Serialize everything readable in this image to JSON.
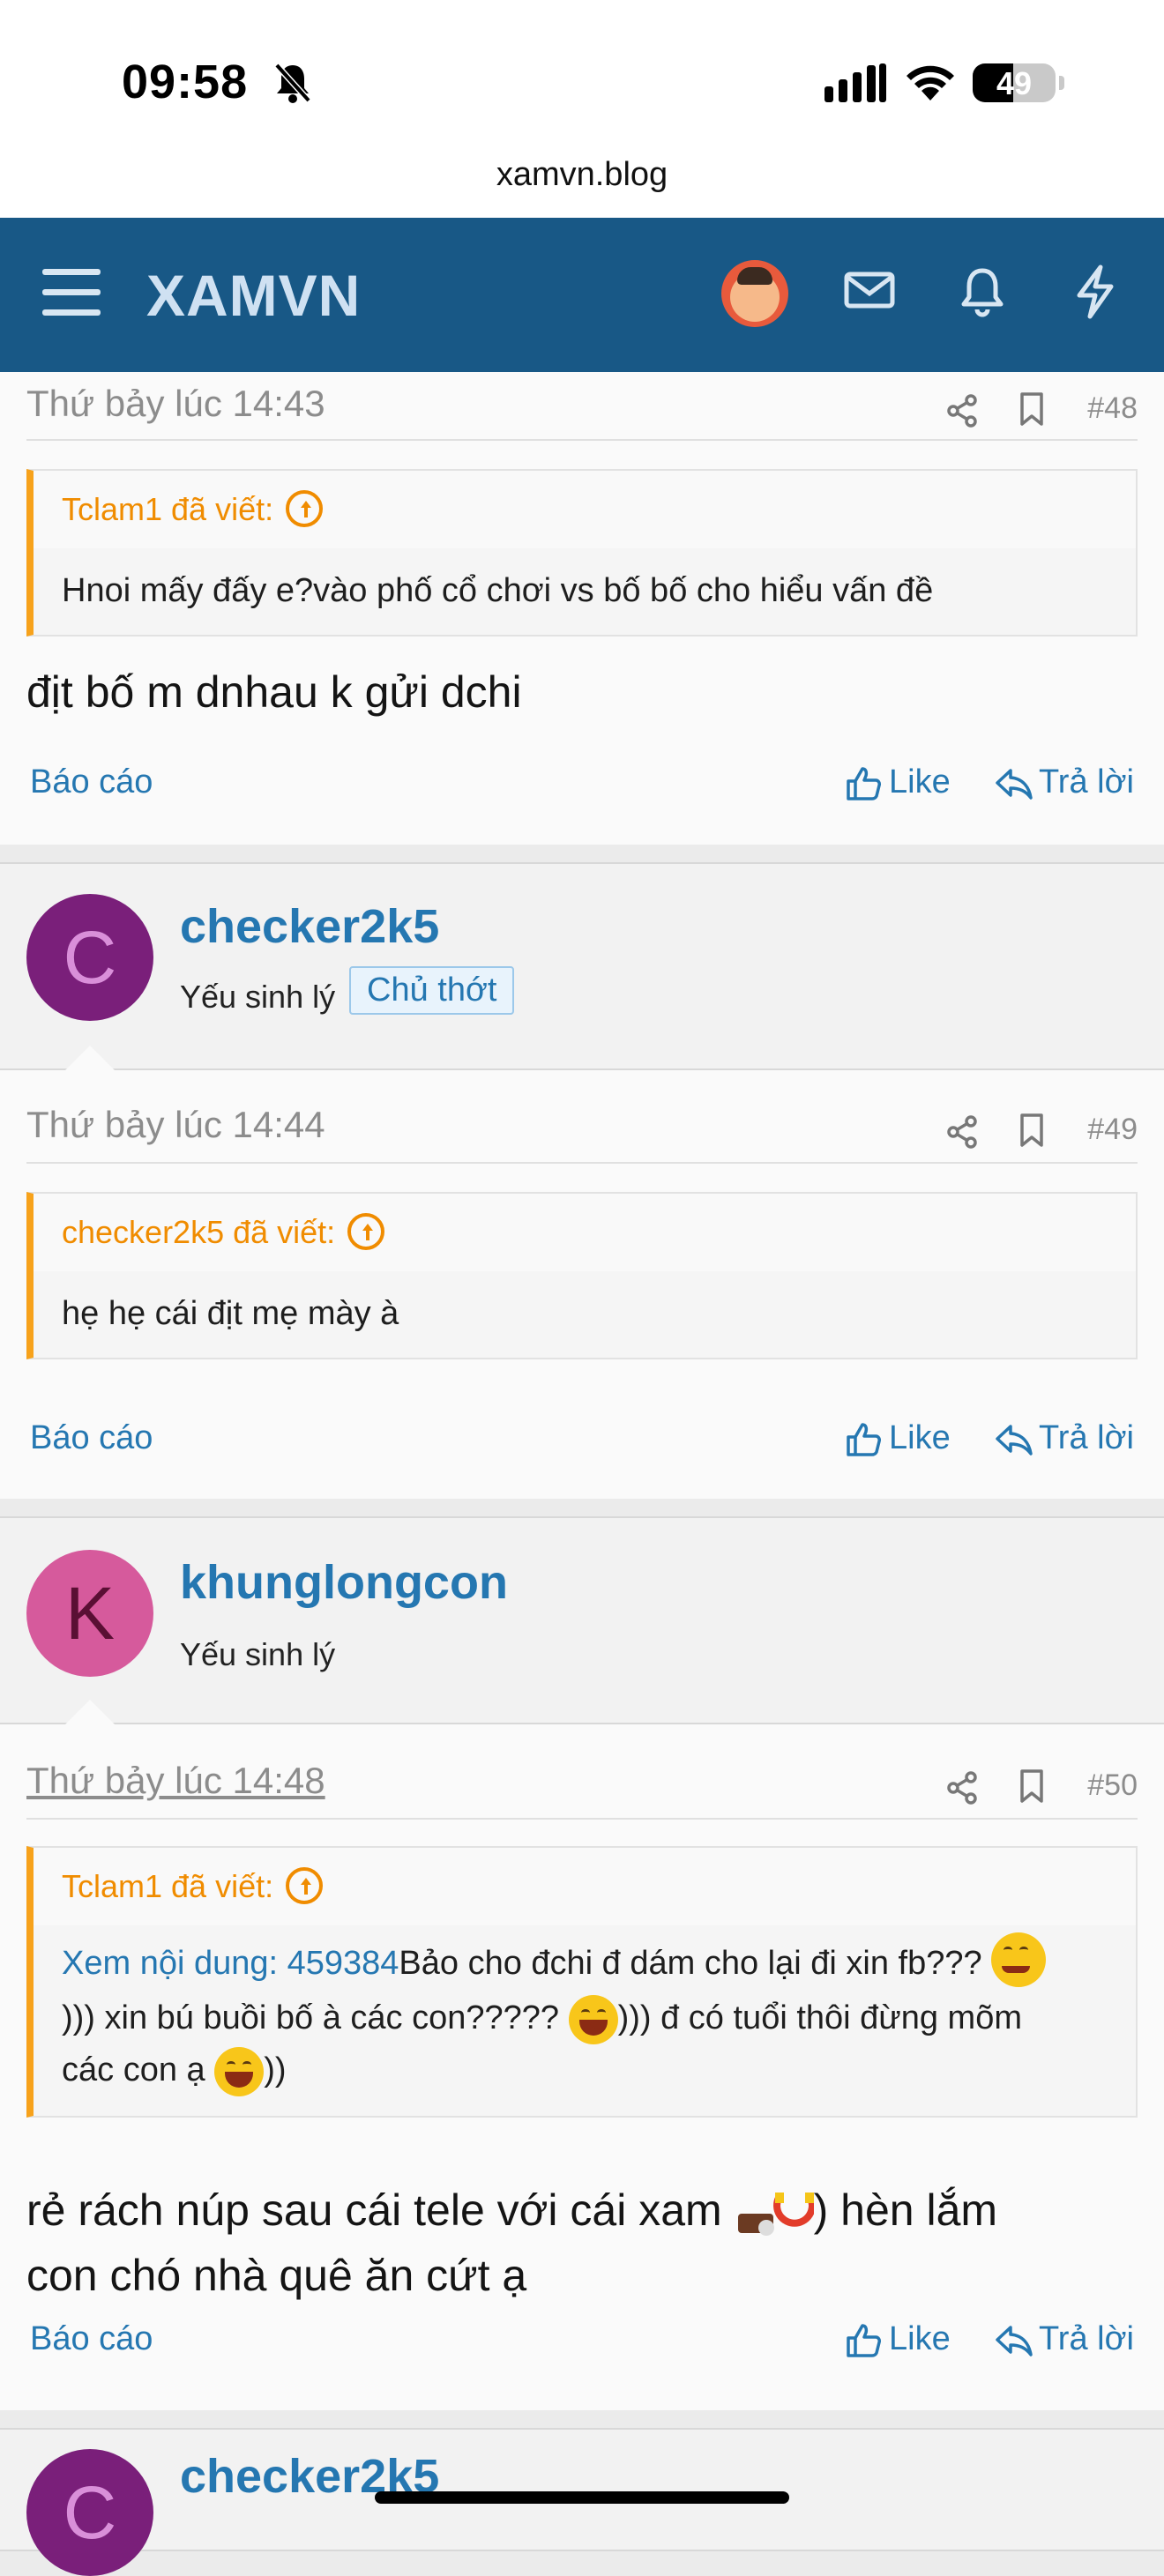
{
  "status": {
    "time": "09:58",
    "battery": "49"
  },
  "browser": {
    "url": "xamvn.blog"
  },
  "app": {
    "brand": "XAMVN"
  },
  "posts": [
    {
      "time": "Thứ bảy lúc 14:43",
      "number": "#48",
      "quote_author": "Tclam1 đã viết:",
      "quote_text": "Hnoi mấy đấy e?vào phố cổ chơi vs bố bố cho hiểu vấn đề",
      "message": "địt bố m dnhau k gửi dchi",
      "report": "Báo cáo",
      "like": "Like",
      "reply": "Trả lời"
    },
    {
      "time": "Thứ bảy lúc 14:44",
      "number": "#49",
      "quote_author": "checker2k5 đã viết:",
      "quote_text": "hẹ hẹ cái địt mẹ mày à",
      "report": "Báo cáo",
      "like": "Like",
      "reply": "Trả lời"
    },
    {
      "time": "Thứ bảy lúc 14:48",
      "number": "#50",
      "quote_author": "Tclam1 đã viết:",
      "quote_link": "Xem nội dung: 459384",
      "quote_line1": "Bảo cho đchi đ dám cho lại đi xin fb???",
      "quote_line2": "))) xin bú buồi bố à các con?????",
      "quote_line2b": "))) đ có tuổi thôi đừng mõm",
      "quote_line3": "các con ạ",
      "quote_line3b": "))",
      "message_line1": "rẻ rách núp sau cái tele với cái xam",
      "message_line1b": ") hèn lắm",
      "message_line2": "con chó nhà quê ăn cứt ạ",
      "report": "Báo cáo",
      "like": "Like",
      "reply": "Trả lời"
    }
  ],
  "users": [
    {
      "initial": "C",
      "name": "checker2k5",
      "title": "Yếu sinh lý",
      "badge": "Chủ thớt",
      "avatar_bg": "#7a1f7a",
      "avatar_fg": "#d98fd9"
    },
    {
      "initial": "K",
      "name": "khunglongcon",
      "title": "Yếu sinh lý",
      "avatar_bg": "#d65a9c",
      "avatar_fg": "#5a0f34"
    },
    {
      "initial": "C",
      "name": "checker2k5"
    }
  ],
  "colors": {
    "appbar": "#185886",
    "link": "#2577b1",
    "quote_accent": "#f7a21b"
  },
  "icons": [
    "menu-icon",
    "avatar",
    "mail-icon",
    "bell-icon",
    "bolt-icon",
    "share-icon",
    "bookmark-icon",
    "like-icon",
    "reply-icon",
    "quote-up-icon"
  ]
}
